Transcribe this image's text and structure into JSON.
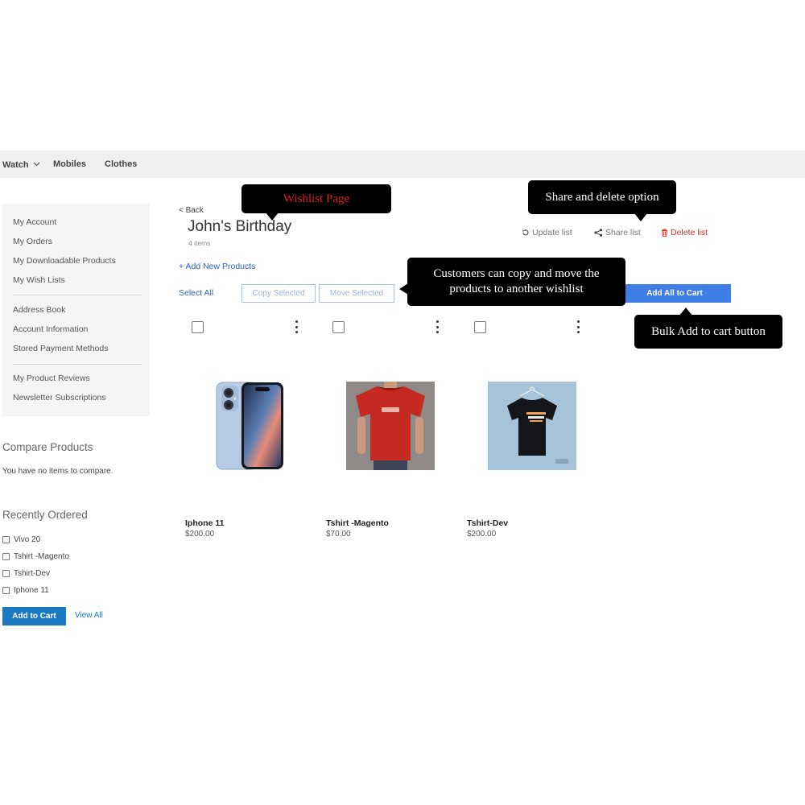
{
  "nav": {
    "items": [
      {
        "label": "Watch",
        "has_dropdown": true
      },
      {
        "label": "Mobiles"
      },
      {
        "label": "Clothes"
      }
    ]
  },
  "sidebar": {
    "links": [
      "My Account",
      "My Orders",
      "My Downloadable Products",
      "My Wish Lists",
      "Address Book",
      "Account Information",
      "Stored Payment Methods",
      "My Product Reviews",
      "Newsletter Subscriptions"
    ]
  },
  "compare": {
    "title": "Compare Products",
    "empty_text": "You have no items to compare."
  },
  "recent": {
    "title": "Recently Ordered",
    "items": [
      "Vivo 20",
      "Tshirt -Magento",
      "Tshirt-Dev",
      "Iphone 11"
    ],
    "add_to_cart": "Add to Cart",
    "view_all": "View All"
  },
  "wishlist": {
    "back": "< Back",
    "title": "John's Birthday",
    "count": "4 items",
    "actions": {
      "update": "Update list",
      "share": "Share list",
      "delete": "Delete list"
    },
    "add_new": "+ Add New Products",
    "select_all": "Select All",
    "copy_selected": "Copy Selected",
    "move_selected": "Move Selected",
    "add_all_to_cart": "Add All to Cart",
    "products": [
      {
        "name": "Iphone 11",
        "price": "$200.00"
      },
      {
        "name": "Tshirt -Magento",
        "price": "$70.00"
      },
      {
        "name": "Tshirt-Dev",
        "price": "$200.00"
      }
    ]
  },
  "callouts": {
    "wishlist_page": "Wishlist Page",
    "share_delete": "Share and delete option",
    "copy_move": "Customers can copy and move the products to another wishlist",
    "bulk_add": "Bulk Add to cart button"
  },
  "colors": {
    "accent_blue": "#1979c3",
    "link_blue": "#2c63c9",
    "add_all_blue": "#3e7ee6",
    "delete_red": "#e02b27",
    "callout_red_text": "#e0191b"
  },
  "icons": {
    "update": "refresh-icon",
    "share": "share-icon",
    "delete": "trash-icon",
    "dropdown": "chevron-down-icon",
    "more": "kebab-menu-icon"
  }
}
